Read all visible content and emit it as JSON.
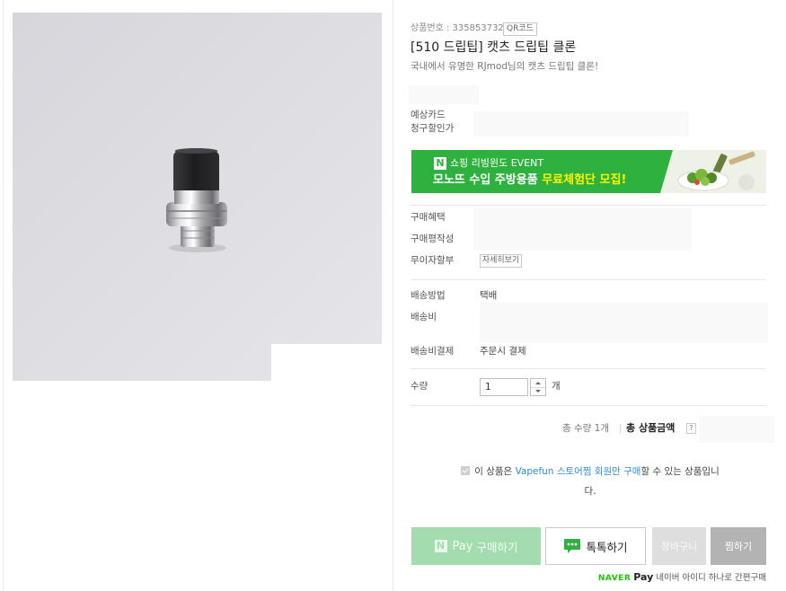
{
  "product": {
    "number_label": "상품번호 : 335853732",
    "qr_label": "QR코드",
    "title": "[510 드립팁] 캣츠 드립팁 클론",
    "subtitle": "국내에서 유명한 RJmod님의 캣츠 드립팁 클론!",
    "image_icon": "drip-tip-photo"
  },
  "card_discount": {
    "label_line1": "예상카드",
    "label_line2": "청구할인가"
  },
  "banner": {
    "badge": "N",
    "line1": "쇼핑 리빙윈도 EVENT",
    "line2_main": "모노뜨 수입 주방용품 ",
    "line2_highlight": "무료체험단 모집!"
  },
  "benefits": {
    "purchase_benefit": "구매혜택",
    "review": "구매평작성",
    "installment": "무이자할부",
    "detail_button": "자세히보기"
  },
  "shipping": {
    "method_label": "배송방법",
    "method_value": "택배",
    "fee_label": "배송비",
    "payment_label": "배송비결제",
    "payment_value": "주문시 결제"
  },
  "quantity": {
    "label": "수량",
    "value": "1",
    "unit": "개"
  },
  "total": {
    "qty_text": "총 수량 1개",
    "separator": "|",
    "amount_label": "총 상품금액",
    "help": "?"
  },
  "notice": {
    "prefix": "이 상품은 ",
    "link": "Vapefun 스토어찜 회원만 구매",
    "suffix": "할 수 있는 상품입니다."
  },
  "buttons": {
    "npay_badge": "N",
    "npay_pay": "Pay",
    "npay_action": "구매하기",
    "talk": "톡톡하기",
    "cart": "장바구니",
    "wish": "찜하기"
  },
  "footer": {
    "naver": "NAVER",
    "pay": "Pay",
    "text": "네이버 아이디 하나로 간편구매"
  },
  "colors": {
    "brand_green": "#2eb13f",
    "banner_highlight": "#fff200",
    "npay_disabled": "#a3dcae",
    "cart_disabled": "#dedede",
    "wish_button": "#b3b3b3",
    "notice_link": "#2d8ed4",
    "naver_green": "#1ec800"
  }
}
